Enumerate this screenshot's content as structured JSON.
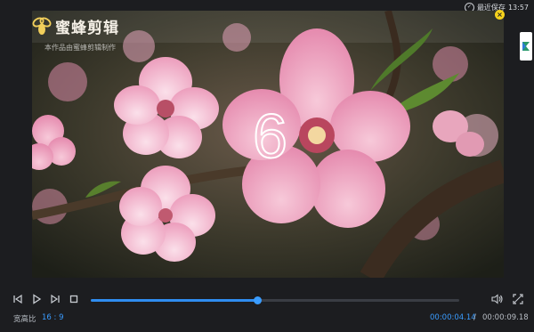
{
  "status": {
    "save_label": "最近保存",
    "save_time": "13:57"
  },
  "brand": {
    "name": "蜜蜂剪辑",
    "subtitle": "本作品由蜜蜂剪辑制作"
  },
  "preview": {
    "countdown": "6",
    "close_icon": "×"
  },
  "player": {
    "progress": 0.452,
    "aspect_label": "宽高比",
    "aspect_value": "16 : 9",
    "current_time": "00:00:04.14",
    "separator": "/",
    "total_time": "00:00:09.18"
  },
  "colors": {
    "accent": "#3a9cff",
    "background": "#1c1d20",
    "badge": "#f6d21c"
  }
}
